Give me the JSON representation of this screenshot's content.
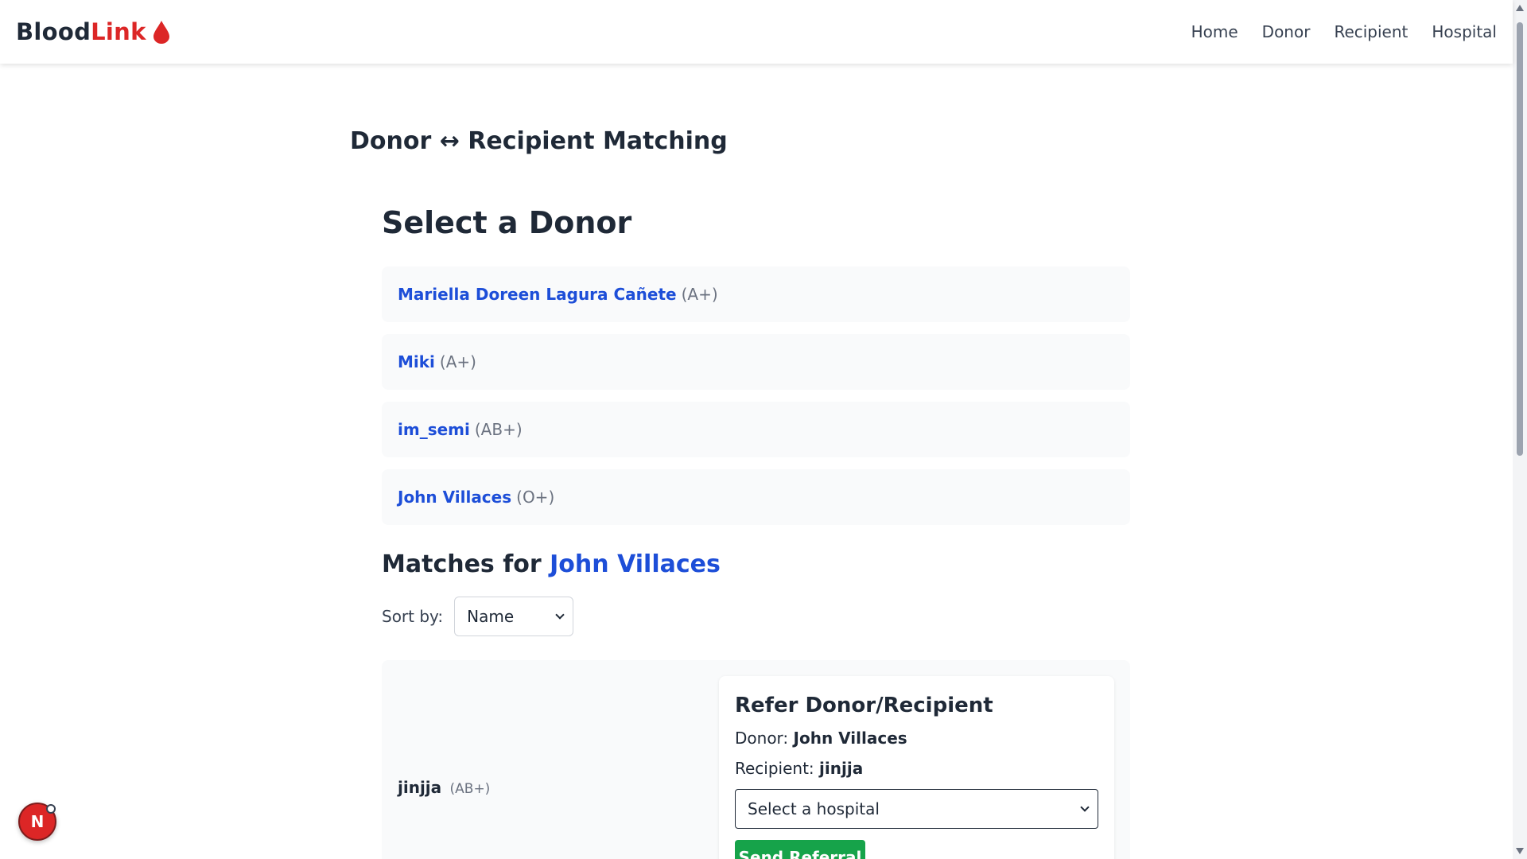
{
  "nav": {
    "brand_part1": "Blood",
    "brand_part2": "Link",
    "brand_icon": "blood-drop-icon",
    "links": [
      "Home",
      "Donor",
      "Recipient",
      "Hospital"
    ]
  },
  "page_title": "Donor ↔ Recipient Matching",
  "donor_section": {
    "title": "Select a Donor",
    "donors": [
      {
        "name": "Mariella Doreen Lagura Cañete",
        "type": "(A+)"
      },
      {
        "name": "Miki",
        "type": "(A+)"
      },
      {
        "name": "im_semi",
        "type": "(AB+)"
      },
      {
        "name": "John Villaces",
        "type": "(O+)"
      }
    ]
  },
  "matches": {
    "title_prefix": "Matches for",
    "selected_donor": "John Villaces",
    "sort_label": "Sort by:",
    "sort_value": "Name",
    "results": [
      {
        "name": "jinjja",
        "type": "(AB+)"
      }
    ]
  },
  "refer": {
    "title": "Refer Donor/Recipient",
    "donor_label": "Donor:",
    "donor_value": "John Villaces",
    "recipient_label": "Recipient:",
    "recipient_value": "jinjja",
    "hospital_placeholder": "Select a hospital",
    "send_label": "Send Referral"
  },
  "badge": {
    "letter": "N"
  },
  "colors": {
    "brand_red": "#dc2626",
    "link_blue": "#1d4ed8",
    "send_green": "#16a34a"
  }
}
